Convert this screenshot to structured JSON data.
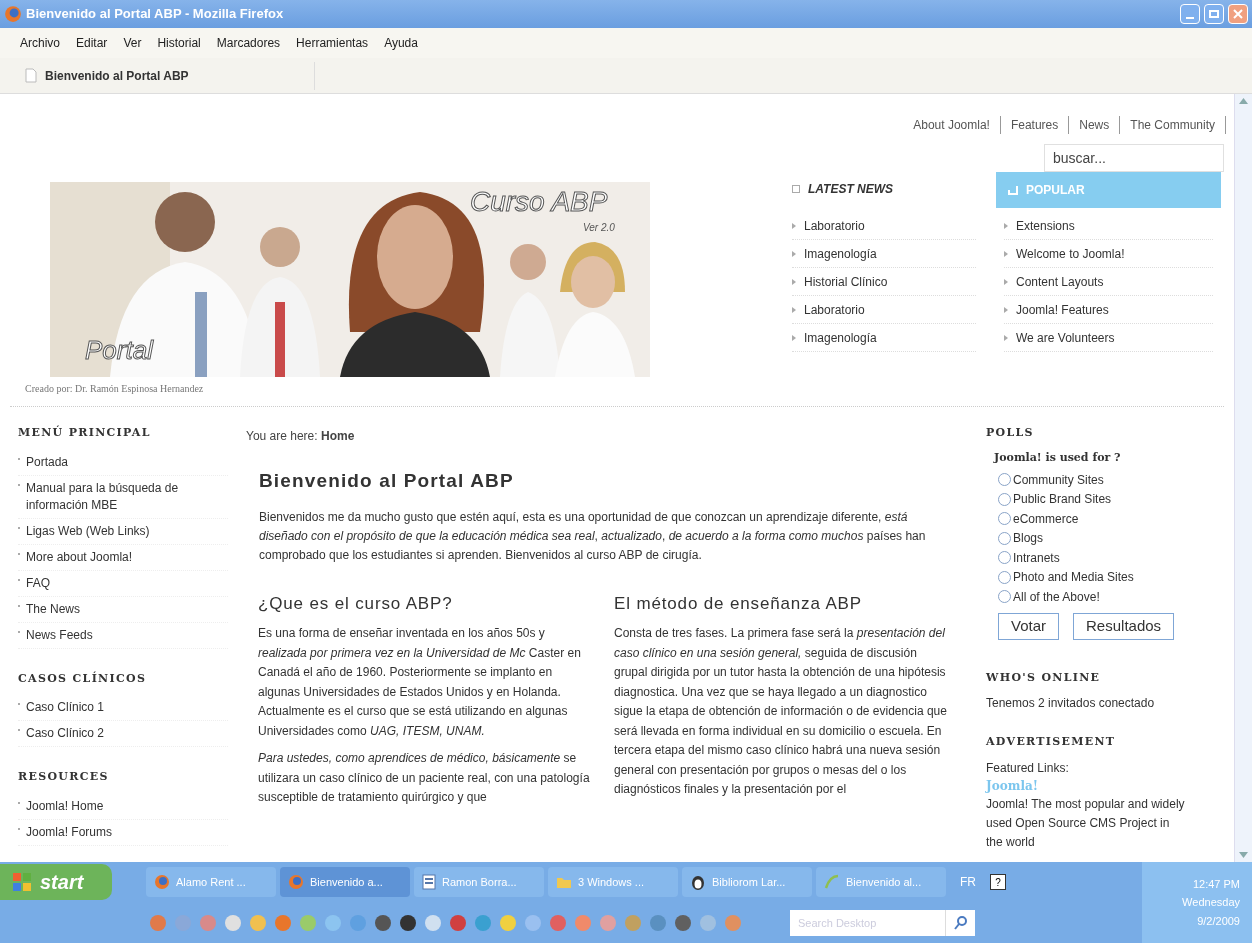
{
  "window": {
    "title": "Bienvenido al Portal ABP - Mozilla Firefox",
    "menu": [
      "Archivo",
      "Editar",
      "Ver",
      "Historial",
      "Marcadores",
      "Herramientas",
      "Ayuda"
    ],
    "tab": "Bienvenido al Portal ABP"
  },
  "top_nav": [
    "About Joomla!",
    "Features",
    "News",
    "The Community"
  ],
  "search": {
    "placeholder": "buscar..."
  },
  "banner": {
    "title": "Curso ABP",
    "version": "Ver 2.0",
    "label": "Portal",
    "credit": "Creado por: Dr. Ramón Espinosa Hernandez"
  },
  "latest_news": {
    "title": "LATEST NEWS",
    "items": [
      "Laboratorio",
      "Imagenología",
      "Historial Clínico",
      "Laboratorio",
      "Imagenología"
    ]
  },
  "popular": {
    "title": "POPULAR",
    "items": [
      "Extensions",
      "Welcome to Joomla!",
      "Content Layouts",
      "Joomla! Features",
      "We are Volunteers"
    ]
  },
  "left_menu": [
    {
      "title": "MENÚ PRINCIPAL",
      "items": [
        "Portada",
        "Manual para la búsqueda de información MBE",
        "Ligas Web (Web Links)",
        "More about Joomla!",
        "FAQ",
        "The News",
        "News Feeds"
      ]
    },
    {
      "title": "CASOS CLÍNICOS",
      "items": [
        "Caso Clínico 1",
        "Caso Clínico 2"
      ]
    },
    {
      "title": "RESOURCES",
      "items": [
        "Joomla! Home",
        "Joomla! Forums"
      ]
    }
  ],
  "breadcrumb": {
    "label": "You are here:",
    "current": "Home"
  },
  "article": {
    "title": "Bienvenido al Portal ABP",
    "intro": "Bienvenidos me da mucho gusto que estén aquí, esta es una oportunidad de que conozcan un aprendizaje diferente, *está diseñado con el propósito de que la educación médica sea real*, *actualizado*, *de acuerdo a la forma como muchos* países han comprobado que los estudiantes si aprenden. Bienvenidos al curso ABP de cirugía.",
    "sections": [
      {
        "heading": "¿Que es el curso ABP?",
        "paragraphs": [
          "Es una forma de enseñar inventada en los años 50s y *realizada por primera vez en la Universidad de Mc* Caster en Canadá el año de 1960. Posteriormente se implanto en algunas Universidades de Estados Unidos y en Holanda. Actualmente es el curso que se está utilizando en algunas Universidades como *UAG, ITESM, UNAM.*",
          "*Para ustedes, como aprendices de médico, básicamente* se utilizara un caso clínico de un paciente real, con una patología susceptible de tratamiento quirúrgico y que"
        ]
      },
      {
        "heading": "El método de enseñanza ABP",
        "paragraphs": [
          "Consta de tres fases. La primera fase será la *presentación del caso clínico en una sesión general,* seguida de discusión grupal dirigida por un tutor hasta la obtención de una hipótesis diagnostica. Una vez que se haya llegado a un diagnostico sigue la etapa de obtención de información o de evidencia que será llevada en forma individual en su domicilio o escuela. En tercera etapa del mismo caso clínico habrá una nueva sesión general con presentación por grupos o mesas del o los diagnósticos finales y la presentación por el"
        ]
      }
    ]
  },
  "polls": {
    "title": "POLLS",
    "question": "Joomla! is used for ?",
    "options": [
      {
        "label": "Community Sites",
        "selected": false
      },
      {
        "label": "Public Brand Sites",
        "selected": false
      },
      {
        "label": "eCommerce",
        "selected": false
      },
      {
        "label": "Blogs",
        "selected": false
      },
      {
        "label": "Intranets",
        "selected": false
      },
      {
        "label": "Photo and Media Sites",
        "selected": false
      },
      {
        "label": "All of the Above!",
        "selected": false
      }
    ],
    "buttons": [
      "Votar",
      "Resultados"
    ]
  },
  "whos_online": {
    "title": "WHO'S ONLINE",
    "text": "Tenemos 2 invitados conectado"
  },
  "advertisement": {
    "title": "ADVERTISEMENT",
    "label": "Featured Links:",
    "link": "Joomla!",
    "text": "Joomla! The most popular and widely used Open Source CMS Project in the world"
  },
  "taskbar": {
    "start": "start",
    "tasks": [
      {
        "label": "Alamo Rent ...",
        "kind": "browser",
        "selected": false
      },
      {
        "label": "Bienvenido a...",
        "kind": "browser",
        "selected": true
      },
      {
        "label": "Ramon Borra...",
        "kind": "document",
        "selected": false
      },
      {
        "label": "3 Windows ...",
        "kind": "folder",
        "selected": false
      },
      {
        "label": "Bibliorom Lar...",
        "kind": "app",
        "selected": false
      },
      {
        "label": "Bienvenido al...",
        "kind": "web",
        "selected": false
      }
    ],
    "language": "FR",
    "help": "?",
    "search_placeholder": "Search Desktop",
    "time": "12:47 PM",
    "day": "Wednesday",
    "date": "9/2/2009"
  }
}
